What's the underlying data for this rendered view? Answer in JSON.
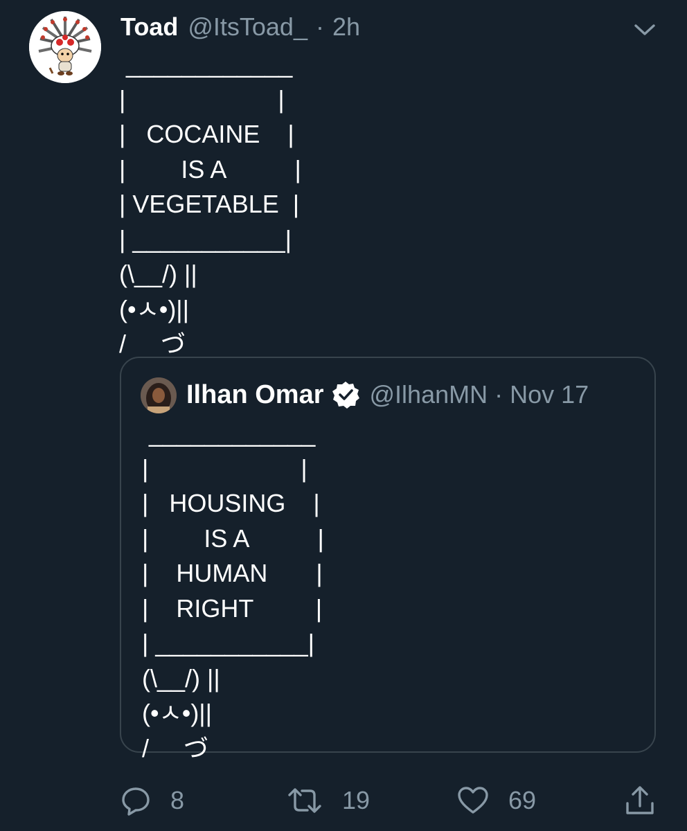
{
  "tweet": {
    "display_name": "Toad",
    "handle": "@ItsToad_",
    "separator": "·",
    "time": "2h",
    "ascii_lines": [
      " ____________",
      "|                      |",
      "|   COCAINE    |",
      "|        IS A          |",
      "| VEGETABLE  |",
      "| ___________|",
      "(\\__/) ||",
      "(•ㅅ•)||",
      "/     づ"
    ],
    "icons": {
      "avatar": "toad-headdress-avatar",
      "caret": "chevron-down-icon"
    }
  },
  "quoted": {
    "display_name": "Ilhan Omar",
    "verified": true,
    "handle": "@IlhanMN",
    "separator": "·",
    "time": "Nov 17",
    "ascii_lines": [
      " ____________",
      "|                      |",
      "|   HOUSING    |",
      "|        IS A          |",
      "|    HUMAN       |",
      "|    RIGHT         |",
      "| ___________|",
      "(\\__/) ||",
      "(•ㅅ•)||",
      "/     づ"
    ]
  },
  "actions": {
    "reply": {
      "icon": "reply-icon",
      "count": "8"
    },
    "retweet": {
      "icon": "retweet-icon",
      "count": "19"
    },
    "like": {
      "icon": "heart-icon",
      "count": "69"
    },
    "share": {
      "icon": "share-icon"
    }
  },
  "colors": {
    "background": "#15202b",
    "text": "#ffffff",
    "muted": "#8899a6",
    "border": "#38444d",
    "verified": "#ffffff"
  }
}
